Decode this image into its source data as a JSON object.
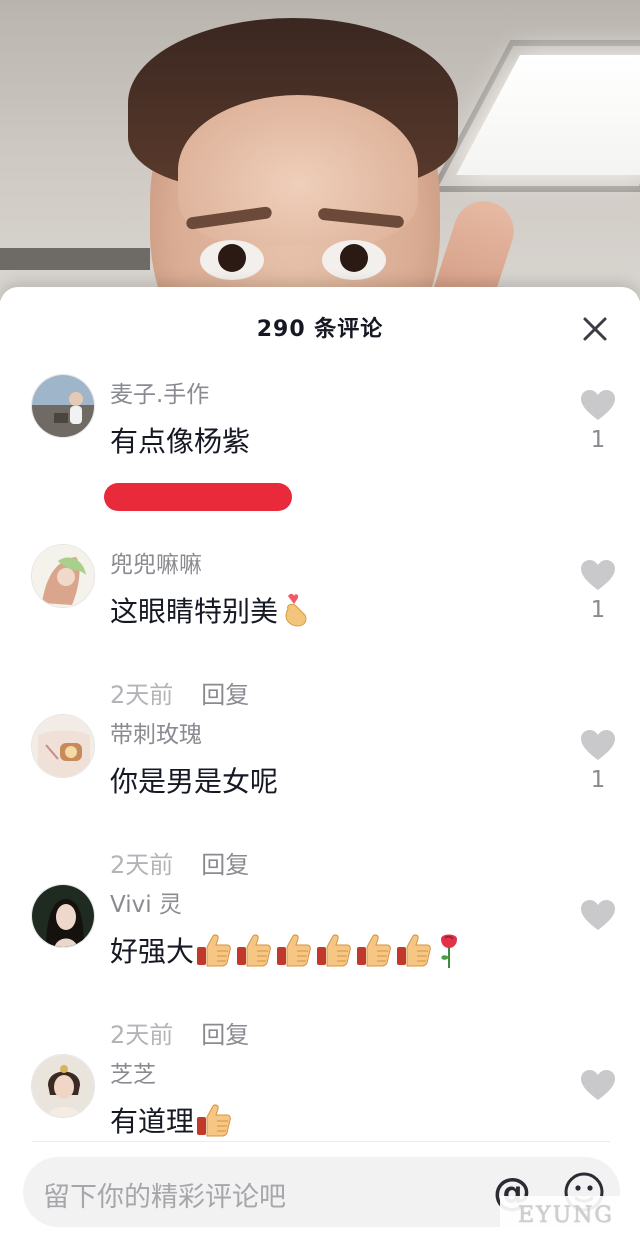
{
  "sheet": {
    "title": "290 条评论"
  },
  "comments": [
    {
      "username": "麦子.手作",
      "text": "有点像杨紫",
      "emojis": [],
      "time": "",
      "reply_label": "",
      "likes": "1",
      "meta_redacted": true
    },
    {
      "username": "兜兜嘛嘛",
      "text": "这眼睛特别美",
      "emojis": [
        "finger-heart"
      ],
      "time": "2天前",
      "reply_label": "回复",
      "likes": "1",
      "meta_redacted": false
    },
    {
      "username": "带刺玫瑰",
      "text": "你是男是女呢",
      "emojis": [],
      "time": "2天前",
      "reply_label": "回复",
      "likes": "1",
      "meta_redacted": false
    },
    {
      "username": "Vivi 灵",
      "text": "好强大",
      "emojis": [
        "thumbs-up",
        "thumbs-up",
        "thumbs-up",
        "thumbs-up",
        "thumbs-up",
        "thumbs-up",
        "rose"
      ],
      "time": "2天前",
      "reply_label": "回复",
      "likes": "",
      "meta_redacted": false
    },
    {
      "username": "芝芝",
      "text": "有道理",
      "emojis": [
        "thumbs-up"
      ],
      "time": "",
      "reply_label": "",
      "likes": "",
      "meta_redacted": false
    }
  ],
  "input": {
    "placeholder": "留下你的精彩评论吧"
  },
  "watermark": "EYUNG",
  "colors": {
    "accent_red": "#e82a3a",
    "text_primary": "#161823",
    "text_secondary": "#8a8b91",
    "text_muted": "#b4b4b8"
  }
}
